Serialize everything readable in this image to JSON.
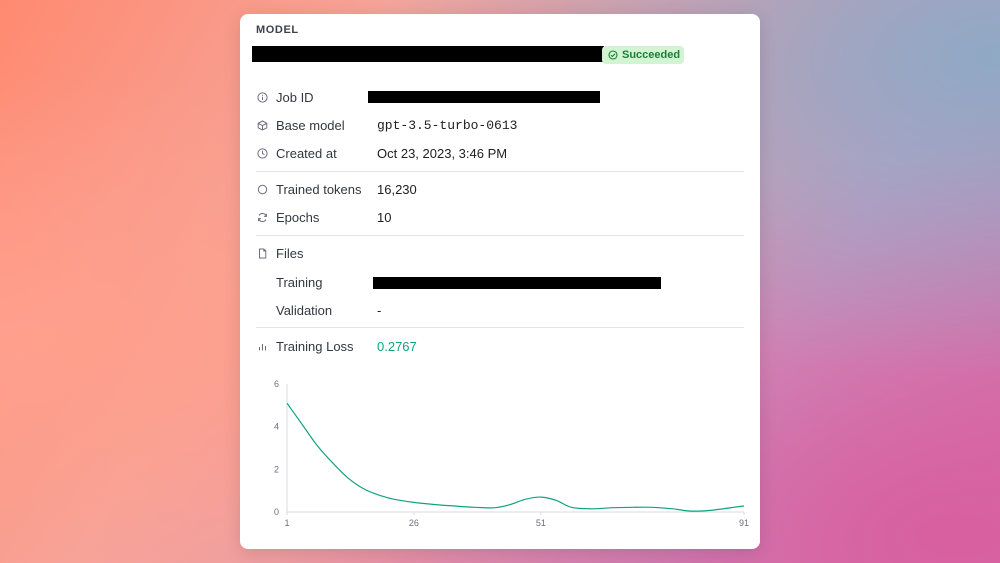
{
  "model": {
    "section_title": "MODEL",
    "status": "Succeeded",
    "status_color": "#1a7f37",
    "status_bg": "#d2f4d3"
  },
  "details": {
    "job_id_label": "Job ID",
    "base_model_label": "Base model",
    "base_model_value": "gpt-3.5-turbo-0613",
    "created_label": "Created at",
    "created_value": "Oct 23, 2023, 3:46 PM",
    "trained_tokens_label": "Trained tokens",
    "trained_tokens_value": "16,230",
    "epochs_label": "Epochs",
    "epochs_value": "10",
    "files_label": "Files",
    "training_label": "Training",
    "validation_label": "Validation",
    "validation_value": "-",
    "training_loss_label": "Training Loss",
    "training_loss_value": "0.2767"
  },
  "chart_data": {
    "type": "line",
    "x_ticks": [
      "1",
      "26",
      "51",
      "91"
    ],
    "y_ticks": [
      "0",
      "2",
      "4",
      "6"
    ],
    "xlim": [
      1,
      91
    ],
    "ylim": [
      0,
      6
    ],
    "line_color": "#10a37f",
    "series": [
      {
        "x": [
          1,
          4,
          7,
          10,
          13,
          16,
          19,
          22,
          26,
          30,
          34,
          38,
          42,
          45,
          48,
          51,
          54,
          57,
          61,
          65,
          69,
          73,
          77,
          80,
          83,
          86,
          89,
          91
        ],
        "y": [
          5.1,
          4.1,
          3.1,
          2.3,
          1.6,
          1.1,
          0.8,
          0.6,
          0.45,
          0.35,
          0.28,
          0.22,
          0.2,
          0.35,
          0.6,
          0.7,
          0.55,
          0.22,
          0.15,
          0.2,
          0.22,
          0.22,
          0.15,
          0.05,
          0.05,
          0.12,
          0.22,
          0.28
        ]
      }
    ]
  }
}
